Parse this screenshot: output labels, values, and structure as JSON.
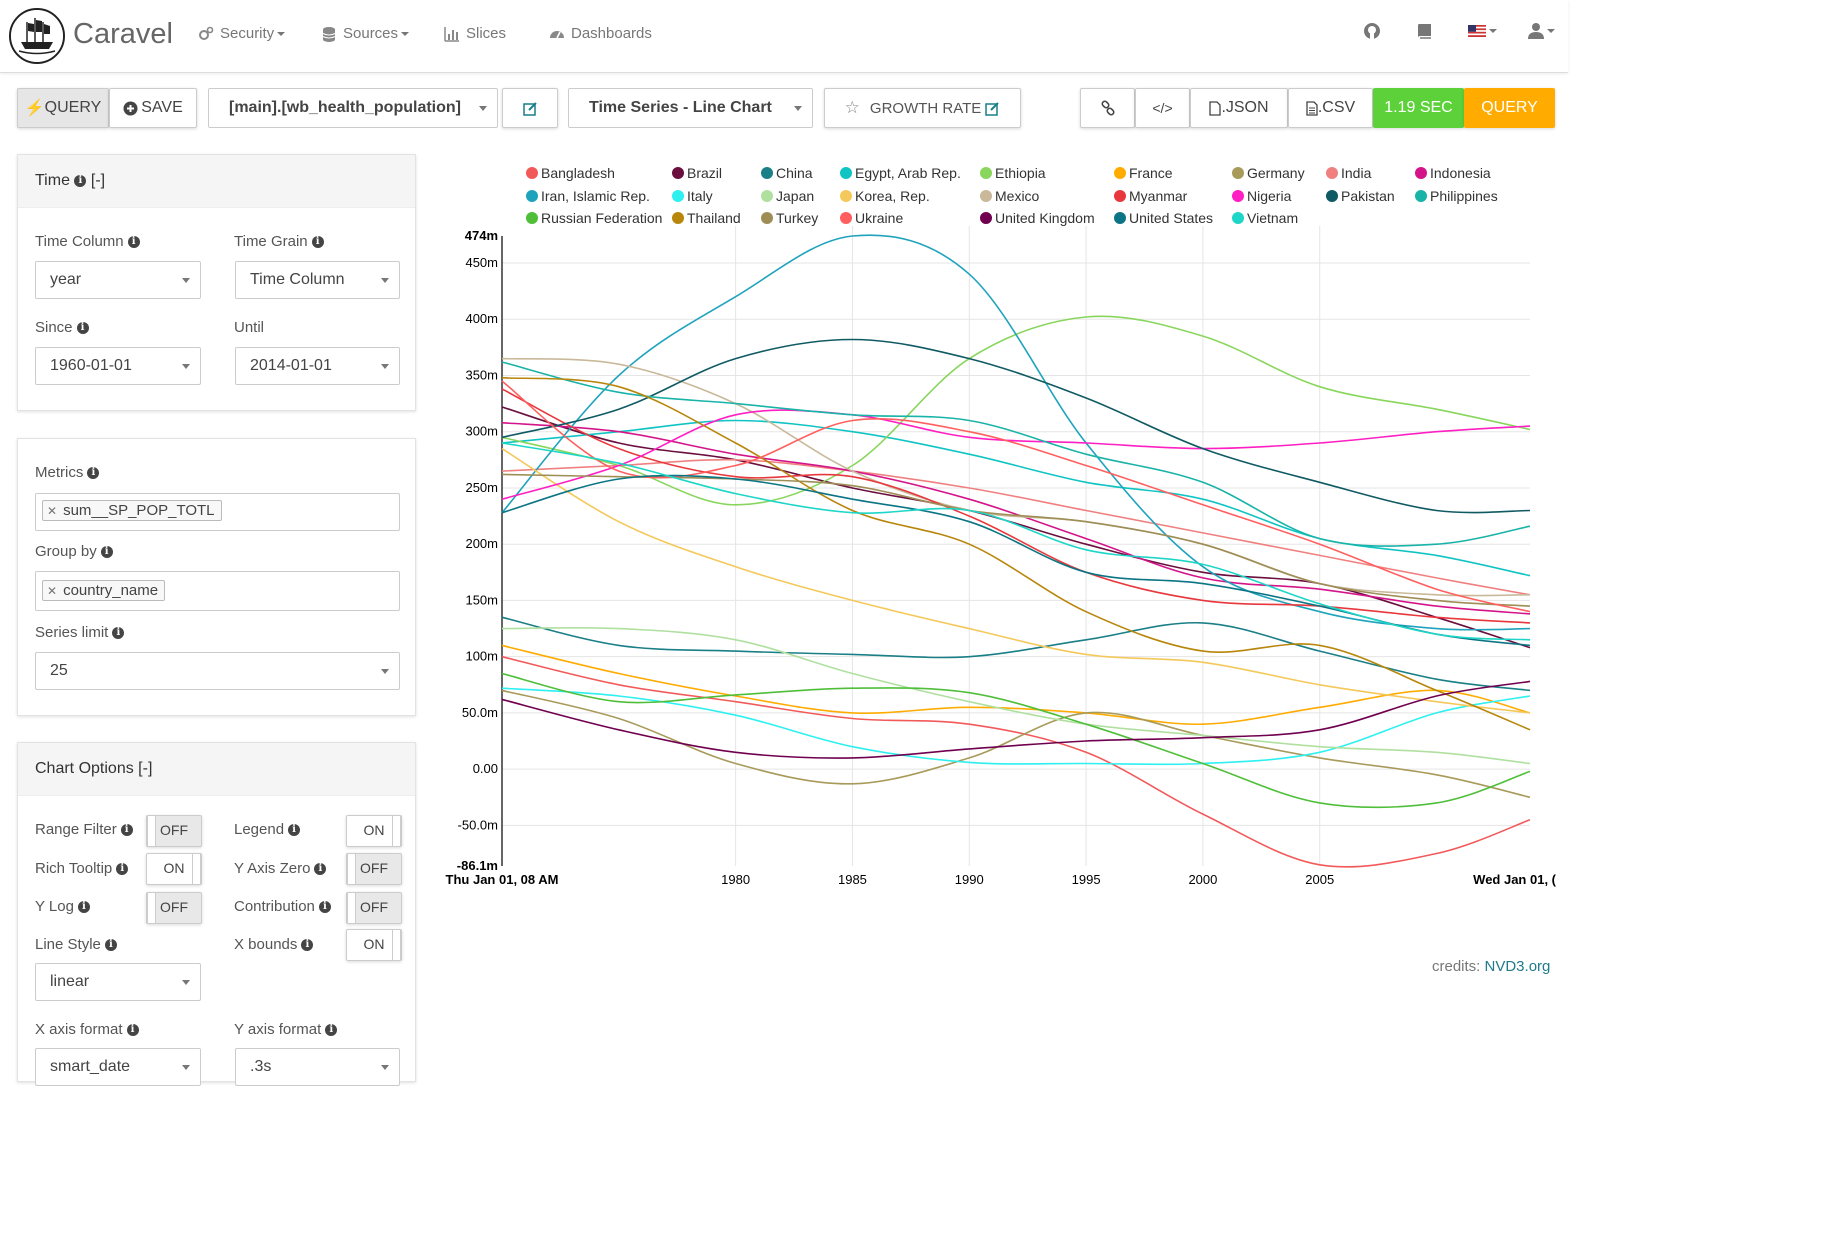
{
  "navbar": {
    "brand": "Caravel",
    "items": [
      {
        "label": "Security",
        "icon": "gears-icon",
        "caret": true
      },
      {
        "label": "Sources",
        "icon": "database-icon",
        "caret": true
      },
      {
        "label": "Slices",
        "icon": "bar-chart-icon",
        "caret": false
      },
      {
        "label": "Dashboards",
        "icon": "dashboard-icon",
        "caret": false
      }
    ],
    "right_icons": [
      "github-icon",
      "book-icon",
      "us-flag-icon",
      "user-icon"
    ]
  },
  "toolbar": {
    "query_label": "QUERY",
    "save_label": "SAVE",
    "datasource": "[main].[wb_health_population]",
    "viz_type": "Time Series - Line Chart",
    "slice_name": "GROWTH RATE",
    "json_label": ".JSON",
    "csv_label": ".CSV",
    "timer": "1.19 SEC",
    "query_right_label": "QUERY",
    "colors": {
      "timer": "#5cd13a",
      "query": "#ffab00"
    }
  },
  "time_panel": {
    "title": "Time",
    "collapse": "[-]",
    "time_column_label": "Time Column",
    "time_column_value": "year",
    "time_grain_label": "Time Grain",
    "time_grain_value": "Time Column",
    "since_label": "Since",
    "since_value": "1960-01-01",
    "until_label": "Until",
    "until_value": "2014-01-01"
  },
  "query_panel": {
    "metrics_label": "Metrics",
    "metric_tag": "sum__SP_POP_TOTL",
    "groupby_label": "Group by",
    "groupby_tag": "country_name",
    "series_limit_label": "Series limit",
    "series_limit_value": "25"
  },
  "chart_options": {
    "title": "Chart Options",
    "collapse": "[-]",
    "range_filter_label": "Range Filter",
    "range_filter": "OFF",
    "legend_label": "Legend",
    "legend": "ON",
    "rich_tooltip_label": "Rich Tooltip",
    "rich_tooltip": "ON",
    "y_axis_zero_label": "Y Axis Zero",
    "y_axis_zero": "OFF",
    "y_log_label": "Y Log",
    "y_log": "OFF",
    "contribution_label": "Contribution",
    "contribution": "OFF",
    "line_style_label": "Line Style",
    "x_bounds_label": "X bounds",
    "x_bounds": "ON",
    "line_style_value": "linear",
    "x_axis_format_label": "X axis format",
    "x_axis_format_value": "smart_date",
    "y_axis_format_label": "Y axis format",
    "y_axis_format_value": ".3s"
  },
  "credits": {
    "prefix": "credits: ",
    "link": "NVD3.org"
  },
  "chart_data": {
    "type": "line",
    "ylim": [
      -86.1,
      474
    ],
    "y_ticks": [
      {
        "v": 474,
        "label": "474m"
      },
      {
        "v": 450,
        "label": "450m"
      },
      {
        "v": 400,
        "label": "400m"
      },
      {
        "v": 350,
        "label": "350m"
      },
      {
        "v": 300,
        "label": "300m"
      },
      {
        "v": 250,
        "label": "250m"
      },
      {
        "v": 200,
        "label": "200m"
      },
      {
        "v": 150,
        "label": "150m"
      },
      {
        "v": 100,
        "label": "100m"
      },
      {
        "v": 50,
        "label": "50.0m"
      },
      {
        "v": 0,
        "label": "0.00"
      },
      {
        "v": -50,
        "label": "-50.0m"
      },
      {
        "v": -86.1,
        "label": "-86.1m"
      }
    ],
    "xlim": [
      1970,
      2014
    ],
    "x_ticks": [
      {
        "v": 1970,
        "label": "Thu Jan 01, 08 AM",
        "bold": true
      },
      {
        "v": 1980,
        "label": "1980"
      },
      {
        "v": 1985,
        "label": "1985"
      },
      {
        "v": 1990,
        "label": "1990"
      },
      {
        "v": 1995,
        "label": "1995"
      },
      {
        "v": 2000,
        "label": "2000"
      },
      {
        "v": 2005,
        "label": "2005"
      },
      {
        "v": 2014,
        "label": "Wed Jan 01, (",
        "bold": true
      }
    ],
    "x": [
      1970,
      1975,
      1980,
      1985,
      1990,
      1995,
      2000,
      2005,
      2010,
      2014
    ],
    "series": [
      {
        "name": "Bangladesh",
        "color": "#f25a5a",
        "values": [
          100,
          75,
          60,
          45,
          40,
          15,
          -40,
          -85,
          -75,
          -45
        ]
      },
      {
        "name": "Brazil",
        "color": "#6b0f3f",
        "values": [
          322,
          290,
          275,
          250,
          230,
          200,
          175,
          165,
          135,
          108
        ]
      },
      {
        "name": "China",
        "color": "#1a7f86",
        "values": [
          135,
          110,
          105,
          102,
          100,
          115,
          130,
          105,
          80,
          70
        ]
      },
      {
        "name": "Egypt, Arab Rep.",
        "color": "#11c4c4",
        "values": [
          290,
          300,
          310,
          300,
          280,
          255,
          240,
          205,
          190,
          172
        ]
      },
      {
        "name": "Ethiopia",
        "color": "#88d65c",
        "values": [
          295,
          270,
          235,
          270,
          365,
          402,
          385,
          340,
          320,
          302
        ]
      },
      {
        "name": "France",
        "color": "#ffab00",
        "values": [
          110,
          85,
          65,
          50,
          55,
          50,
          40,
          55,
          70,
          50
        ]
      },
      {
        "name": "Germany",
        "color": "#a89a5a",
        "values": [
          70,
          45,
          5,
          -13,
          10,
          50,
          30,
          10,
          -5,
          -25
        ]
      },
      {
        "name": "India",
        "color": "#f08080",
        "values": [
          265,
          270,
          275,
          265,
          250,
          230,
          210,
          190,
          170,
          155
        ]
      },
      {
        "name": "Indonesia",
        "color": "#d4158a",
        "values": [
          308,
          300,
          280,
          265,
          240,
          205,
          170,
          160,
          145,
          138
        ]
      },
      {
        "name": "Iran, Islamic Rep.",
        "color": "#1fa3bd",
        "values": [
          228,
          350,
          420,
          475,
          440,
          290,
          180,
          140,
          125,
          125
        ]
      },
      {
        "name": "Italy",
        "color": "#2ef0f0",
        "values": [
          72,
          65,
          48,
          20,
          6,
          5,
          5,
          15,
          50,
          65
        ]
      },
      {
        "name": "Japan",
        "color": "#b0e0a0",
        "values": [
          125,
          125,
          115,
          85,
          60,
          40,
          30,
          20,
          15,
          5
        ]
      },
      {
        "name": "Korea, Rep.",
        "color": "#f5c85a",
        "values": [
          285,
          220,
          180,
          150,
          125,
          102,
          95,
          75,
          60,
          50
        ]
      },
      {
        "name": "Mexico",
        "color": "#c9b99a",
        "values": [
          365,
          360,
          325,
          265,
          230,
          220,
          200,
          165,
          155,
          155
        ]
      },
      {
        "name": "Myanmar",
        "color": "#e8383d",
        "values": [
          338,
          285,
          260,
          260,
          225,
          175,
          150,
          145,
          135,
          130
        ]
      },
      {
        "name": "Nigeria",
        "color": "#ff1fc3",
        "values": [
          240,
          270,
          315,
          315,
          295,
          290,
          285,
          290,
          300,
          305
        ]
      },
      {
        "name": "Pakistan",
        "color": "#0f5a63",
        "values": [
          295,
          320,
          365,
          382,
          365,
          330,
          285,
          255,
          230,
          230
        ]
      },
      {
        "name": "Philippines",
        "color": "#19b3a8",
        "values": [
          362,
          335,
          325,
          315,
          310,
          280,
          255,
          205,
          200,
          216
        ]
      },
      {
        "name": "Russian Federation",
        "color": "#4fbf3a",
        "values": [
          85,
          60,
          66,
          72,
          68,
          40,
          5,
          -30,
          -30,
          -2
        ]
      },
      {
        "name": "Thailand",
        "color": "#b8860b",
        "values": [
          348,
          340,
          290,
          230,
          200,
          140,
          105,
          110,
          70,
          35
        ]
      },
      {
        "name": "Turkey",
        "color": "#9e8e56",
        "values": [
          262,
          260,
          258,
          252,
          230,
          220,
          200,
          165,
          150,
          145
        ]
      },
      {
        "name": "Ukraine",
        "color": "#ff5f5f",
        "values": [
          345,
          265,
          270,
          310,
          300,
          270,
          235,
          200,
          160,
          140
        ]
      },
      {
        "name": "United Kingdom",
        "color": "#70004f",
        "values": [
          62,
          35,
          15,
          10,
          18,
          25,
          28,
          35,
          65,
          78
        ]
      },
      {
        "name": "United States",
        "color": "#0c7585",
        "values": [
          228,
          258,
          258,
          240,
          220,
          175,
          165,
          145,
          120,
          110
        ]
      },
      {
        "name": "Vietnam",
        "color": "#1ed6c7",
        "values": [
          290,
          272,
          245,
          228,
          230,
          195,
          182,
          147,
          120,
          115
        ]
      }
    ]
  }
}
